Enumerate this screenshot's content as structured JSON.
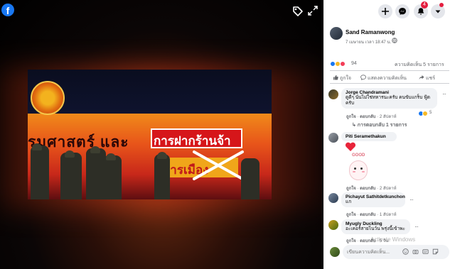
{
  "viewer": {
    "brand_letter": "f",
    "photo_text_main": "รมศาสตร์ และ",
    "photo_text_overlay": "การฝากร้านจ้า",
    "photo_text_crossed": "การเมือง"
  },
  "post": {
    "author": "Sand Ramanwong",
    "timestamp": "7 เมษายน เวลา 18:47 น.",
    "reactions_count": "94",
    "comments_count": "ความคิดเห็น 5 รายการ",
    "actions": {
      "like": "ถูกใจ",
      "comment": "แสดงความคิดเห็น",
      "share": "แชร์"
    }
  },
  "comments": [
    {
      "name": "Jorge Chandramani",
      "text": "ดูดีๆ นั่นไม่ใช่ทหารนะครับ คนขับแกร็บ ฟู้ดครับ",
      "like": "ถูกใจ",
      "reply": "ตอบกลับ",
      "time": "2 สัปดาห์",
      "reacts": "5"
    },
    {
      "name": "Piti Seramethakun",
      "text": "",
      "like": "ถูกใจ",
      "reply": "ตอบกลับ",
      "time": "2 สัปดาห์",
      "sticker_text": "GOOD"
    },
    {
      "name": "Pichayut Sathitdetkunchon",
      "text": "แก",
      "like": "ถูกใจ",
      "reply": "ตอบกลับ",
      "time": "1 สัปดาห์"
    },
    {
      "name": "Myugly Duckling",
      "text": "อะเคอร์สายไนว์น พรุ่งนี้เข้าพะ",
      "like": "ถูกใจ",
      "reply": "ตอบกลับ",
      "time": "5 วัน"
    }
  ],
  "replies_link": "↳ การตอบกลับ 1 รายการ",
  "compose": {
    "placeholder": "เขียนความคิดเห็น..."
  },
  "notifications_count": "4",
  "watermark": "Activate Windows",
  "colors": {
    "facebook_blue": "#1877f2",
    "notif_red": "#e41e3f",
    "panel_bg": "#ffffff"
  }
}
